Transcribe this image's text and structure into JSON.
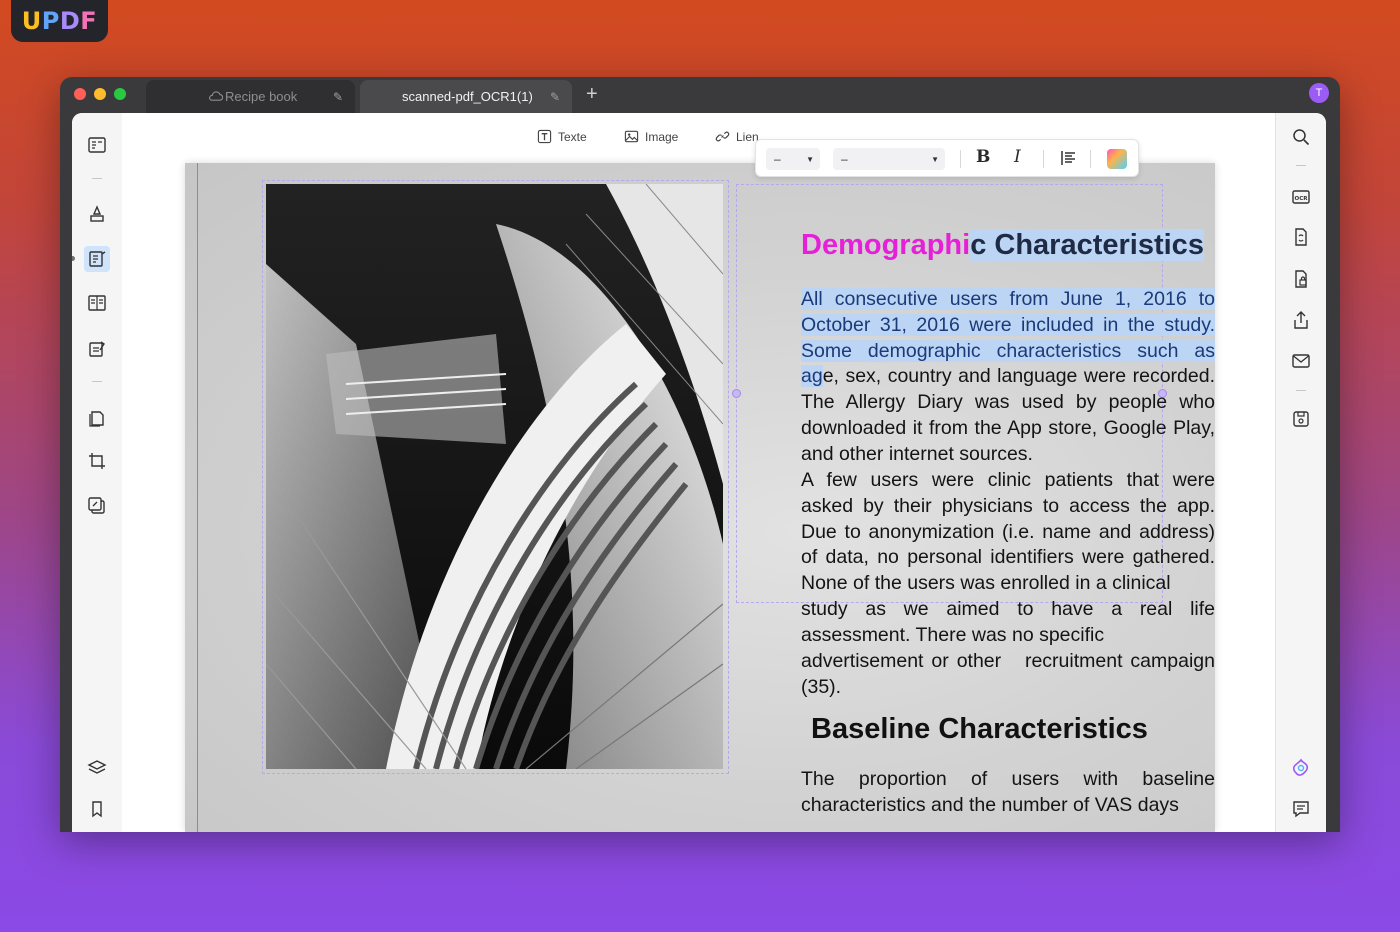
{
  "brand": {
    "logo": "UPDF"
  },
  "tabs": [
    {
      "label": "Recipe book",
      "active": false
    },
    {
      "label": "scanned-pdf_OCR1(1)",
      "active": true
    }
  ],
  "user": {
    "avatar_initial": "T"
  },
  "toolbar": {
    "text_label": "Texte",
    "image_label": "Image",
    "link_label": "Lien"
  },
  "format_bar": {
    "font_size": "–",
    "font_family": "–",
    "bold": "B",
    "italic": "I"
  },
  "document": {
    "heading1_part1": "Demographi",
    "heading1_part2": "c",
    "heading1_part3": " Characteristics",
    "para1_lines": [
      "All consecutive users from June 1, 2016 to",
      "October 31, 2016 were included in the study.",
      "Some demographic characteristics such as",
      "age, sex, country and language were recorded.",
      "The Allergy Diary was used by people who",
      "downloaded it from the App store, Google Play,",
      "and other internet sources."
    ],
    "para1_line4_sel": "ag",
    "para1_line4_rest": "e, sex, country and language were recorded.",
    "para2_lines": [
      "A few users were clinic patients that were",
      "asked by their physicians to access the app.",
      "Due to anonymization (i.e. name and address)",
      "of data, no personal identifiers were gathered.",
      "None of the users was enrolled in a clinical",
      "study as we aimed to have a real life",
      "assessment. There was no specific"
    ],
    "para3_lines": [
      "advertisement or other   recruitment campaign",
      "(35)."
    ],
    "heading2": "Baseline Characteristics",
    "para4_lines": [
      "The proportion of users with baseline",
      "characteristics and the number of VAS days"
    ]
  },
  "colors": {
    "accent": "#9b5cf6",
    "selection": "#bcd5f4",
    "heading_pink": "#e520d8"
  }
}
